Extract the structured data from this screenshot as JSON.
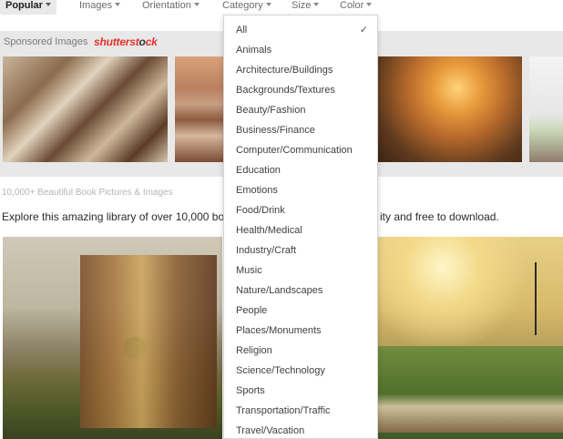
{
  "filters": [
    {
      "label": "Popular"
    },
    {
      "label": "Images"
    },
    {
      "label": "Orientation"
    },
    {
      "label": "Category"
    },
    {
      "label": "Size"
    },
    {
      "label": "Color"
    }
  ],
  "sponsored": {
    "label": "Sponsored Images",
    "brand_red": "shutterst",
    "brand_dark": "o",
    "brand_tail": "ck"
  },
  "content": {
    "count_text": "10,000+ Beautiful Book Pictures & Images",
    "description_start": "Explore this amazing library of over 10,000 book",
    "description_end": "ity and free to download."
  },
  "dropdown": {
    "selected": "All",
    "check_icon": "✓",
    "options": [
      "All",
      "Animals",
      "Architecture/Buildings",
      "Backgrounds/Textures",
      "Beauty/Fashion",
      "Business/Finance",
      "Computer/Communication",
      "Education",
      "Emotions",
      "Food/Drink",
      "Health/Medical",
      "Industry/Craft",
      "Music",
      "Nature/Landscapes",
      "People",
      "Places/Monuments",
      "Religion",
      "Science/Technology",
      "Sports",
      "Transportation/Traffic",
      "Travel/Vacation"
    ]
  },
  "colors": {
    "brand_red": "#e4322d",
    "band_gray": "#e8e8e8"
  }
}
